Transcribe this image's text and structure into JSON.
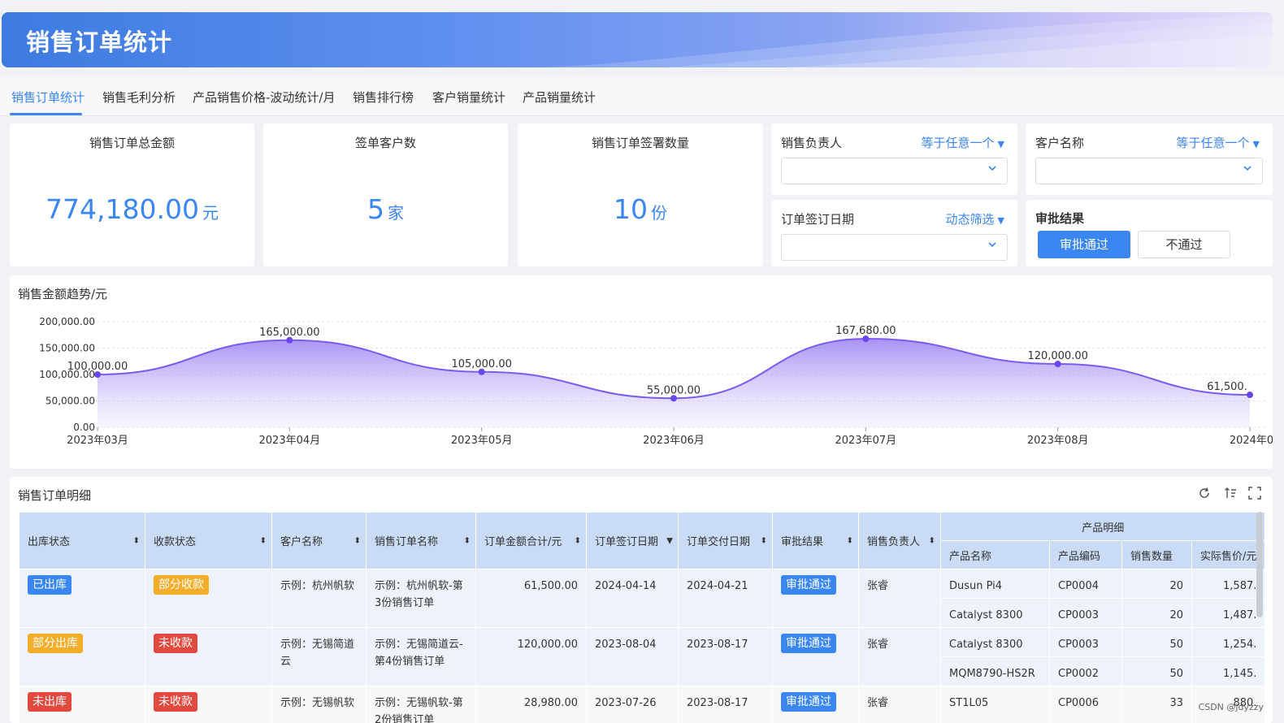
{
  "banner": {
    "title": "销售订单统计"
  },
  "tabs": [
    "销售订单统计",
    "销售毛利分析",
    "产品销售价格-波动统计/月",
    "销售排行榜",
    "客户销量统计",
    "产品销量统计"
  ],
  "kpis": [
    {
      "title": "销售订单总金额",
      "value": "774,180.00",
      "unit": "元"
    },
    {
      "title": "签单客户数",
      "value": "5",
      "unit": "家"
    },
    {
      "title": "销售订单签署数量",
      "value": "10",
      "unit": "份"
    }
  ],
  "filters": {
    "owner": {
      "label": "销售负责人",
      "mode": "等于任意一个"
    },
    "customer": {
      "label": "客户名称",
      "mode": "等于任意一个"
    },
    "date": {
      "label": "订单签订日期",
      "mode": "动态筛选"
    },
    "approval": {
      "label": "审批结果",
      "approve": "审批通过",
      "reject": "不通过"
    }
  },
  "chart_title": "销售金额趋势/元",
  "chart_data": {
    "type": "area",
    "categories": [
      "2023年03月",
      "2023年04月",
      "2023年05月",
      "2023年06月",
      "2023年07月",
      "2023年08月",
      "2024年0"
    ],
    "values": [
      100000,
      165000,
      105000,
      55000,
      167680,
      120000,
      61500
    ],
    "data_labels": [
      "100,000.00",
      "165,000.00",
      "105,000.00",
      "55,000.00",
      "167,680.00",
      "120,000.00",
      "61,500."
    ],
    "y_ticks": [
      "0.00",
      "50,000.00",
      "100,000.00",
      "150,000.00",
      "200,000.00"
    ],
    "ylim": [
      0,
      200000
    ],
    "grid": true,
    "color": "#7b5cf0"
  },
  "table": {
    "title": "销售订单明细",
    "headers": [
      "出库状态",
      "收款状态",
      "客户名称",
      "销售订单名称",
      "订单金额合计/元",
      "订单签订日期",
      "订单交付日期",
      "审批结果",
      "销售负责人"
    ],
    "group_header": "产品明细",
    "sub_headers": [
      "产品名称",
      "产品编码",
      "销售数量",
      "实际售价/元"
    ],
    "rows": [
      {
        "ship": "已出库",
        "ship_color": "blue",
        "pay": "部分收款",
        "pay_color": "orange",
        "customer": "示例：杭州帆软",
        "order": "示例：杭州帆软-第3份销售订单",
        "amount": "61,500.00",
        "sign": "2024-04-14",
        "deliver": "2024-04-21",
        "approval": "审批通过",
        "owner": "张睿",
        "products": [
          {
            "name": "Dusun Pi4",
            "code": "CP0004",
            "qty": "20",
            "price": "1,587."
          },
          {
            "name": "Catalyst 8300",
            "code": "CP0003",
            "qty": "20",
            "price": "1,487."
          }
        ]
      },
      {
        "ship": "部分出库",
        "ship_color": "orange",
        "pay": "未收款",
        "pay_color": "red",
        "customer": "示例：无锡简道云",
        "order": "示例：无锡简道云-第4份销售订单",
        "amount": "120,000.00",
        "sign": "2023-08-04",
        "deliver": "2023-08-17",
        "approval": "审批通过",
        "owner": "张睿",
        "products": [
          {
            "name": "Catalyst 8300",
            "code": "CP0003",
            "qty": "50",
            "price": "1,254."
          },
          {
            "name": "MQM8790-HS2R",
            "code": "CP0002",
            "qty": "50",
            "price": "1,145."
          }
        ]
      },
      {
        "ship": "未出库",
        "ship_color": "red",
        "pay": "未收款",
        "pay_color": "red",
        "customer": "示例：无锡帆软",
        "order": "示例：无锡帆软-第2份销售订单",
        "amount": "28,980.00",
        "sign": "2023-07-26",
        "deliver": "2023-08-17",
        "approval": "审批通过",
        "owner": "张睿",
        "products": [
          {
            "name": "ST1L05",
            "code": "CP0006",
            "qty": "33",
            "price": "880."
          }
        ]
      }
    ]
  },
  "watermark": "CSDN @jdyzzy"
}
